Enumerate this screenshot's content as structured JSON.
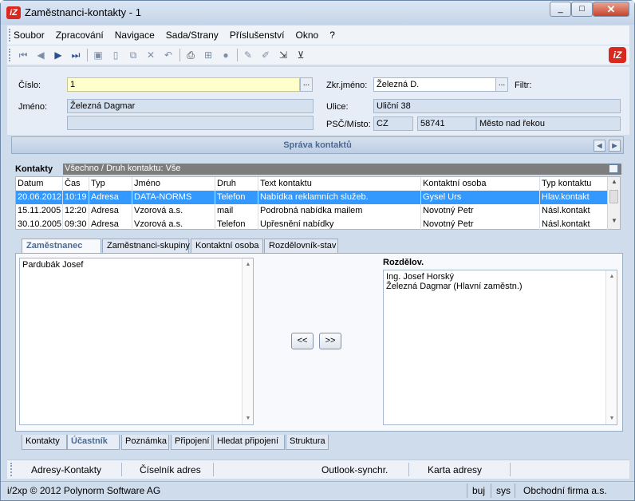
{
  "window": {
    "title": "Zaměstnanci-kontakty - 1",
    "app_icon": "iZ",
    "minimize": "_",
    "maximize": "□",
    "close": "✕"
  },
  "menu": [
    "Soubor",
    "Zpracování",
    "Navigace",
    "Sada/Strany",
    "Příslušenství",
    "Okno",
    "?"
  ],
  "toolbar": {
    "icons": [
      "first-icon",
      "prev-icon",
      "next-icon",
      "last-icon",
      "save-icon",
      "new-icon",
      "copy-icon",
      "delete-icon",
      "undo-icon",
      "print-icon",
      "tree-icon",
      "disabled-icon",
      "edit-icon",
      "pencil-icon",
      "export-icon",
      "filter-icon"
    ],
    "logo": "iZ"
  },
  "form": {
    "cislo_label": "Číslo:",
    "cislo_value": "1",
    "jmeno_label": "Jméno:",
    "jmeno_value": "Železná Dagmar",
    "jmeno2_value": "",
    "zkr_label": "Zkr.jméno:",
    "zkr_value": "Železná D.",
    "filtr_label": "Filtr:",
    "ulice_label": "Ulice:",
    "ulice_value": "Uliční 38",
    "psc_label": "PSČ/Místo:",
    "country": "CZ",
    "psc": "58741",
    "misto": "Město nad řekou",
    "dots": "..."
  },
  "panel": {
    "title": "Správa kontaktů"
  },
  "contacts": {
    "label": "Kontakty",
    "filter": "Všechno / Druh kontaktu: Vše",
    "columns": [
      "Datum",
      "Čas",
      "Typ",
      "Jméno",
      "Druh",
      "Text kontaktu",
      "Kontaktní osoba",
      "Typ kontaktu"
    ],
    "rows": [
      [
        "20.06.2012",
        "10:19",
        "Adresa",
        "DATA-NORMS",
        "Telefon",
        "Nabídka reklamních služeb.",
        "Gysel Urs",
        "Hlav.kontakt"
      ],
      [
        "15.11.2005",
        "12:20",
        "Adresa",
        "Vzorová a.s.",
        "mail",
        "Podrobná nabídka mailem",
        "Novotný Petr",
        "Násl.kontakt"
      ],
      [
        "30.10.2005",
        "09:30",
        "Adresa",
        "Vzorová a.s.",
        "Telefon",
        "Upřesnění nabídky",
        "Novotný Petr",
        "Násl.kontakt"
      ]
    ]
  },
  "tabs": [
    "Zaměstnanec",
    "Zaměstnanci-skupiny",
    "Kontaktní osoba",
    "Rozdělovník-stav"
  ],
  "left_list": [
    "Pardubák Josef"
  ],
  "right_title": "Rozdělov.",
  "right_list": [
    "Ing. Josef Horský",
    "Železná Dagmar (Hlavní zaměstn.)"
  ],
  "buttons": {
    "move_left": "<<",
    "move_right": ">>"
  },
  "bottom_tabs": [
    "Kontakty",
    "Účastník",
    "Poznámka",
    "Připojení",
    "Hledat připojení",
    "Struktura"
  ],
  "actions": [
    "Adresy-Kontakty",
    "Číselník adres",
    "Outlook-synchr.",
    "Karta adresy"
  ],
  "status": {
    "copyright": "i/2xp © 2012 Polynorm Software AG",
    "user": "buj",
    "sys": "sys",
    "firm": "Obchodní firma a.s."
  }
}
